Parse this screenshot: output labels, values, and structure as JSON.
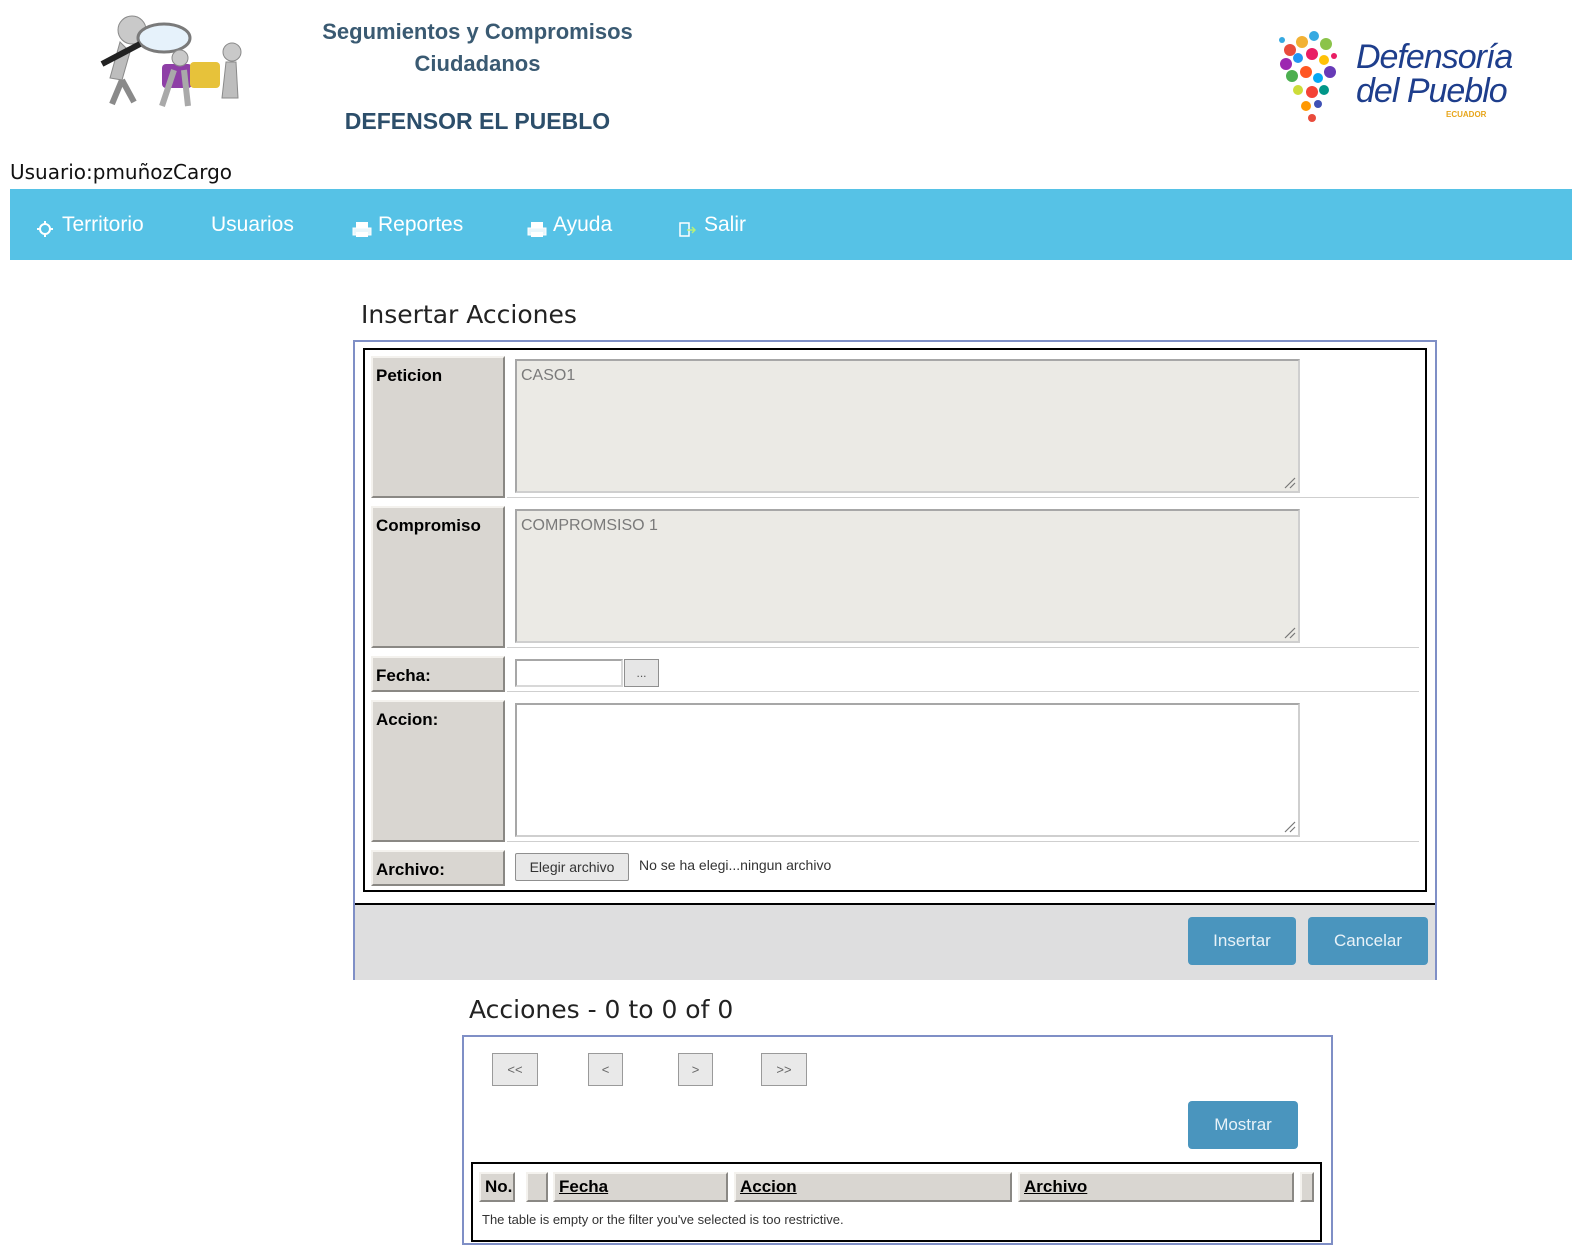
{
  "header": {
    "app_title_line1": "Segumientos y Compromisos",
    "app_title_line2": "Ciudadanos",
    "org_title": "DEFENSOR EL PUEBLO",
    "logo_right_line1": "Defensoría",
    "logo_right_line2": "del Pueblo",
    "logo_right_sub": "ECUADOR",
    "user_label": "Usuario:",
    "user_value": "pmuñozCargo"
  },
  "nav": {
    "items": [
      {
        "label": "Territorio",
        "icon": "gear-icon"
      },
      {
        "label": "Usuarios",
        "icon": ""
      },
      {
        "label": "Reportes",
        "icon": "printer-icon"
      },
      {
        "label": "Ayuda",
        "icon": "printer-icon"
      },
      {
        "label": "Salir",
        "icon": "exit-icon"
      }
    ]
  },
  "form": {
    "title": "Insertar Acciones",
    "peticion_label": "Peticion",
    "peticion_value": "CASO1",
    "compromiso_label": "Compromiso",
    "compromiso_value": "COMPROMSISO 1",
    "fecha_label": "Fecha:",
    "fecha_value": "",
    "fecha_button": "...",
    "accion_label": "Accion:",
    "accion_value": "",
    "archivo_label": "Archivo:",
    "archivo_button": "Elegir archivo",
    "archivo_status": "No se ha elegi...ningun archivo",
    "insert_button": "Insertar",
    "cancel_button": "Cancelar"
  },
  "list": {
    "title": "Acciones - 0 to 0 of 0",
    "pager": {
      "first": "<<",
      "prev": "<",
      "next": ">",
      "last": ">>"
    },
    "show_button": "Mostrar",
    "columns": {
      "no": "No.",
      "fecha": "Fecha",
      "accion": "Accion",
      "archivo": "Archivo"
    },
    "empty_message": "The table is empty or the filter you've selected is too restrictive."
  },
  "colors": {
    "nav_bg": "#56c2e6",
    "button_bg": "#4a95be",
    "panel_border": "#7f8fc6",
    "label_bg": "#d9d6d1"
  }
}
